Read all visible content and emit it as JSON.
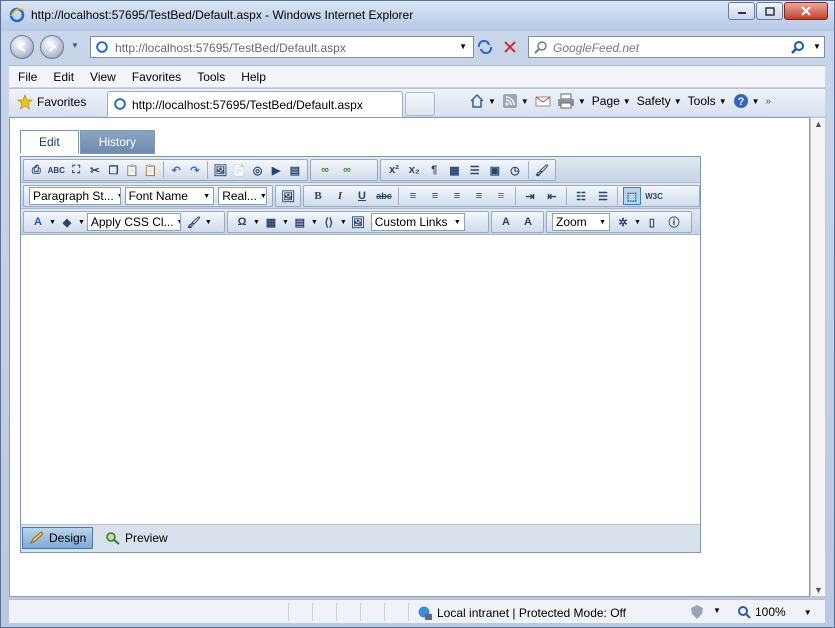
{
  "window": {
    "title": "http://localhost:57695/TestBed/Default.aspx - Windows Internet Explorer"
  },
  "address": {
    "url": "http://localhost:57695/TestBed/Default.aspx"
  },
  "search": {
    "placeholder": "GoogleFeed.net"
  },
  "menu": [
    "File",
    "Edit",
    "View",
    "Favorites",
    "Tools",
    "Help"
  ],
  "favorites_label": "Favorites",
  "tab": {
    "title": "http://localhost:57695/TestBed/Default.aspx"
  },
  "commands": {
    "page": "Page",
    "safety": "Safety",
    "tools": "Tools"
  },
  "editor": {
    "tabs": [
      "Edit",
      "History"
    ],
    "dropdowns": {
      "paragraph_style": "Paragraph St...",
      "font_name": "Font Name",
      "font_size": "Real...",
      "css_class": "Apply CSS Cl...",
      "custom_links": "Custom Links",
      "zoom": "Zoom"
    },
    "modes": {
      "design": "Design",
      "preview": "Preview"
    }
  },
  "status": {
    "zone": "Local intranet | Protected Mode: Off",
    "zoom": "100%"
  },
  "colors": {
    "accent": "#7ea9d4",
    "frame": "#c7d6ee"
  }
}
